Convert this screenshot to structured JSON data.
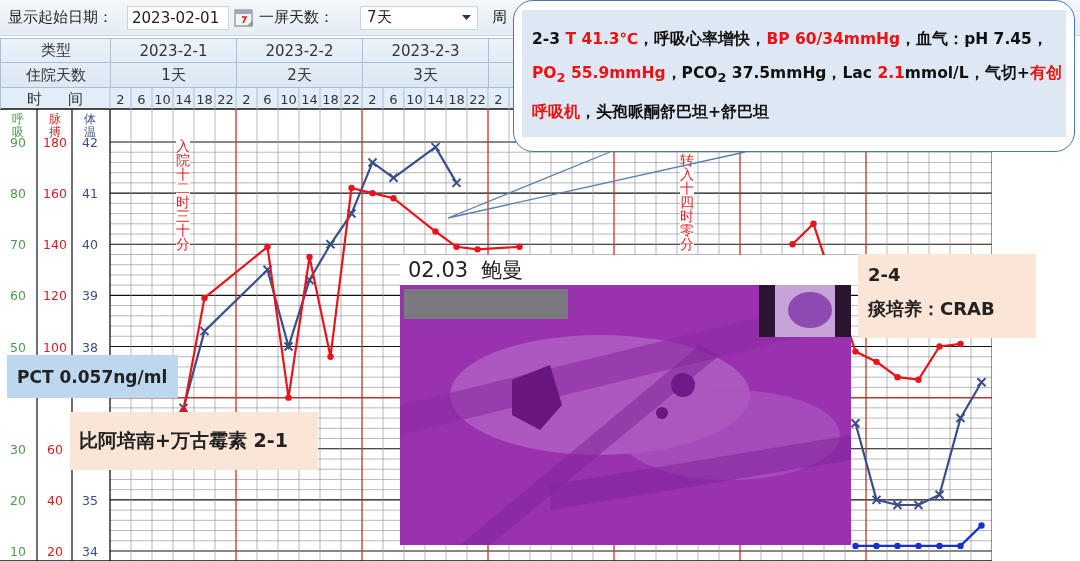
{
  "toolbar": {
    "start_date_label": "显示起始日期：",
    "start_date": "2023-02-01",
    "days_label": "一屏天数：",
    "days_value": "7天",
    "weeks_label": "周"
  },
  "header": {
    "type_label": "类型",
    "stay_label": "住院天数",
    "days": [
      {
        "date": "2023-2-1",
        "stay": "1天"
      },
      {
        "date": "2023-2-2",
        "stay": "2天"
      },
      {
        "date": "2023-2-3",
        "stay": "3天"
      }
    ]
  },
  "chart": {
    "annotations": [
      {
        "text": "入院十二时三十分"
      },
      {
        "text": "转入十四时零分"
      }
    ],
    "time_label": "时 间",
    "chart_data": {
      "type": "line",
      "categories": [
        "2",
        "6",
        "10",
        "14",
        "18",
        "22",
        "2",
        "6",
        "10",
        "14",
        "18",
        "22",
        "2",
        "6",
        "10",
        "14",
        "18",
        "22",
        "2",
        null,
        null,
        null,
        null,
        null,
        null,
        null,
        null,
        null,
        null,
        null,
        null,
        null,
        null,
        null,
        null,
        null,
        null,
        null,
        null,
        null,
        null,
        null
      ],
      "grid": true,
      "ref_lines": [
        {
          "axis": "y",
          "value": 37,
          "color": "#d03030"
        }
      ],
      "ylabel": "体温",
      "ylim": [
        34,
        42
      ],
      "yticks": [
        34,
        35,
        38,
        39,
        40,
        41,
        42
      ],
      "y2label": "脉搏",
      "y2lim": [
        20,
        180
      ],
      "y2ticks": [
        20,
        40,
        60,
        100,
        120,
        140,
        160,
        180
      ],
      "y3label": "呼吸",
      "y3lim": [
        10,
        90
      ],
      "y3ticks": [
        10,
        20,
        30,
        50,
        60,
        70,
        80,
        90
      ],
      "series": [
        {
          "color": "#3b4e8c",
          "marker": "cross",
          "values": [
            null,
            null,
            null,
            36.8,
            38.3,
            null,
            null,
            39.5,
            38.0,
            39.3,
            40.0,
            40.6,
            41.6,
            41.3,
            null,
            41.9,
            41.2,
            null,
            null,
            null,
            null,
            null,
            null,
            null,
            null,
            null,
            null,
            null,
            null,
            null,
            null,
            null,
            null,
            null,
            null,
            36.5,
            35.0,
            34.9,
            34.9,
            35.1,
            36.6,
            37.3
          ]
        },
        {
          "color": "#e8141c",
          "axis": "y2",
          "marker": "dot",
          "values": [
            null,
            null,
            null,
            75,
            119,
            null,
            null,
            139,
            80,
            135,
            96,
            162,
            160,
            158,
            null,
            145,
            139,
            138,
            null,
            139,
            null,
            null,
            null,
            null,
            null,
            null,
            null,
            null,
            null,
            null,
            null,
            null,
            140,
            148,
            null,
            98,
            94,
            88,
            87,
            100,
            101,
            null
          ]
        },
        {
          "color": "#1a2fd0",
          "axis": "y3",
          "marker": "dot",
          "values": [
            null,
            null,
            null,
            null,
            null,
            null,
            null,
            null,
            null,
            null,
            null,
            null,
            null,
            null,
            null,
            null,
            null,
            null,
            null,
            null,
            null,
            null,
            null,
            null,
            null,
            null,
            null,
            null,
            null,
            null,
            null,
            null,
            null,
            null,
            null,
            11,
            11,
            11,
            11,
            11,
            11,
            15
          ]
        }
      ]
    }
  },
  "notes": {
    "callout": [
      {
        "text": "2-3 ",
        "highlight": false
      },
      {
        "text": "T 41.3℃",
        "highlight": true
      },
      {
        "text": "，呼吸心率增快，",
        "highlight": false
      },
      {
        "text": "BP 60/34mmHg",
        "highlight": true
      },
      {
        "text": "，血气：pH 7.45，",
        "highlight": false
      },
      {
        "text": "PO$_{2}$ 55.9mmHg",
        "highlight": true
      },
      {
        "text": "，PCO$_{2}$ 37.5mmHg，Lac ",
        "highlight": false
      },
      {
        "text": "2.1",
        "highlight": true
      },
      {
        "text": "mmol/L，气切+",
        "highlight": false
      },
      {
        "text": "有创呼吸机",
        "highlight": true
      },
      {
        "text": "，头孢哌酮舒巴坦+舒巴坦",
        "highlight": false
      }
    ],
    "pct": "PCT 0.057ng/ml",
    "drug": "比阿培南+万古霉素 2-1",
    "culture_date": "2-4",
    "culture": "痰培养：CRAB",
    "image_caption": "02.03  鲍曼"
  }
}
